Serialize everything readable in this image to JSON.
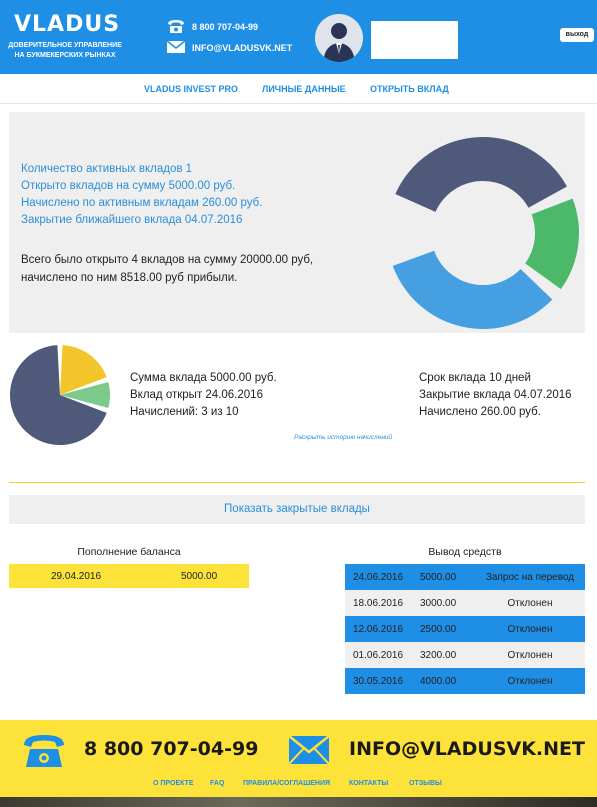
{
  "header": {
    "logo": "VLADUS",
    "tagline": "ДОВЕРИТЕЛЬНОЕ УПРАВЛЕНИЕ НА БУКМЕКЕРСКИХ РЫНКАХ",
    "phone": "8 800 707-04-99",
    "email": "INFO@VLADUSVK.NET",
    "logout_label": "выход",
    "brand_color": "#1f8fe6"
  },
  "nav": {
    "items": [
      {
        "label": "VLADUS INVEST PRO"
      },
      {
        "label": "ЛИЧНЫЕ ДАННЫЕ"
      },
      {
        "label": "ОТКРЫТЬ ВКЛАД"
      }
    ]
  },
  "summary": {
    "active_count": "Количество активных вкладов 1",
    "opened_sum": "Открыто вкладов на сумму 5000.00 руб.",
    "accrued_active": "Начислено по активным вкладам 260.00 руб.",
    "nearest_close": "Закрытие ближайшего вклада 04.07.2016",
    "total_line1": "Всего было открыто 4 вкладов на сумму 20000.00 руб,",
    "total_line2": "начислено по ним 8518.00 руб прибыли.",
    "donut_segments": [
      {
        "color": "#4f5a7a",
        "fraction": 0.375
      },
      {
        "color": "#4cb86a",
        "fraction": 0.18
      },
      {
        "color": "#459fe0",
        "fraction": 0.345
      }
    ]
  },
  "deposit": {
    "amount": "Сумма вклада 5000.00 руб.",
    "opened": "Вклад открыт 24.06.2016",
    "accruals": "Начислений: 3 из 10",
    "term": "Срок вклада 10 дней",
    "closing": "Закрытие вклада 04.07.2016",
    "accrued": "Начислено 260.00 руб.",
    "history_link": "Раскрыть историю начислений",
    "pie_segments": [
      {
        "color": "#f2c62a",
        "fraction": 0.2
      },
      {
        "color": "#7cc98a",
        "fraction": 0.1
      },
      {
        "color": "#4f5a7a",
        "fraction": 0.7
      }
    ]
  },
  "closed_button": "Показать закрытые вклады",
  "deposits_table": {
    "title": "Пополнение баланса",
    "rows": [
      {
        "date": "29.04.2016",
        "amount": "5000.00"
      }
    ]
  },
  "withdrawals_table": {
    "title": "Вывод средств",
    "rows": [
      {
        "date": "24.06.2016",
        "amount": "5000.00",
        "status": "Запрос на перевод"
      },
      {
        "date": "18.06.2016",
        "amount": "3000.00",
        "status": "Отклонен"
      },
      {
        "date": "12.06.2016",
        "amount": "2500.00",
        "status": "Отклонен"
      },
      {
        "date": "01.06.2016",
        "amount": "3200.00",
        "status": "Отклонен"
      },
      {
        "date": "30.05.2016",
        "amount": "4000.00",
        "status": "Отклонен"
      }
    ]
  },
  "footer": {
    "phone": "8 800 707-04-99",
    "email": "INFO@VLADUSVK.NET",
    "links": [
      {
        "label": "О ПРОЕКТЕ"
      },
      {
        "label": "FAQ"
      },
      {
        "label": "ПРАВИЛА/СОГЛАШЕНИЯ"
      },
      {
        "label": "КОНТАКТЫ"
      },
      {
        "label": "ОТЗЫВЫ"
      }
    ],
    "accent_color": "#fde23a"
  }
}
